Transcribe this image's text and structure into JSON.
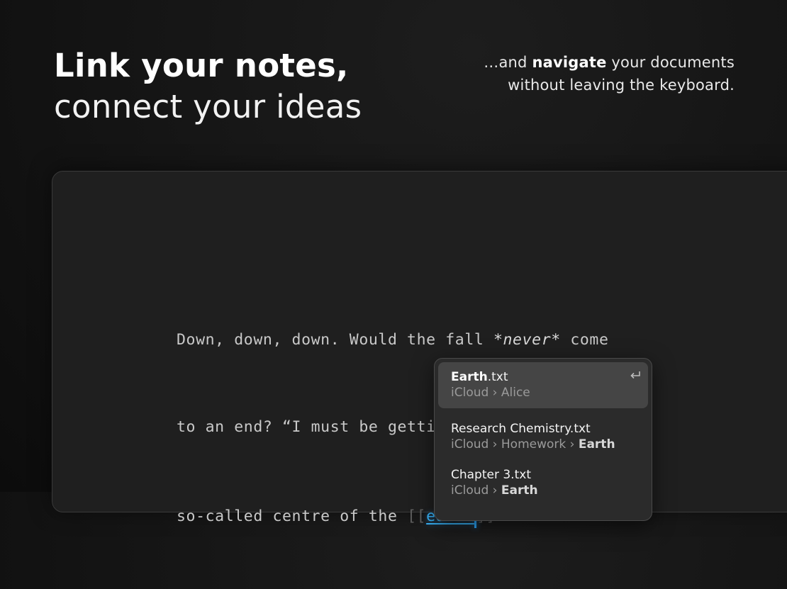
{
  "hero": {
    "headline_bold": "Link your notes,",
    "headline_light": "connect your ideas",
    "tagline_prefix": "…and ",
    "tagline_bold": "navigate",
    "tagline_rest": " your documents",
    "tagline_line2": "without leaving the keyboard."
  },
  "editor": {
    "line1_a": "Down, down, down. Would the fall ",
    "line1_em": "*never*",
    "line1_b": " come",
    "line2": "to an end? “I must be getting somewhere near the",
    "line3_a": "so-called centre of the ",
    "bracket_open": "[[",
    "link_text": "earth",
    "bracket_close": "]]"
  },
  "autocomplete": {
    "items": [
      {
        "title_bold": "Earth",
        "title_rest": ".txt",
        "path_a": "iCloud › Alice",
        "path_bold": "",
        "selected": true,
        "icon": "return-key-icon"
      },
      {
        "title_bold": "",
        "title_rest": "Research Chemistry.txt",
        "path_a": "iCloud › Homework › ",
        "path_bold": "Earth",
        "selected": false
      },
      {
        "title_bold": "",
        "title_rest": "Chapter 3.txt",
        "path_a": "iCloud › ",
        "path_bold": "Earth",
        "selected": false
      }
    ]
  },
  "colors": {
    "background": "#141414",
    "editor_bg": "#1f1f1f",
    "link": "#39b8ff",
    "cursor": "#2aa8ff",
    "popup_bg": "#2b2b2b",
    "popup_selected": "#454545"
  }
}
